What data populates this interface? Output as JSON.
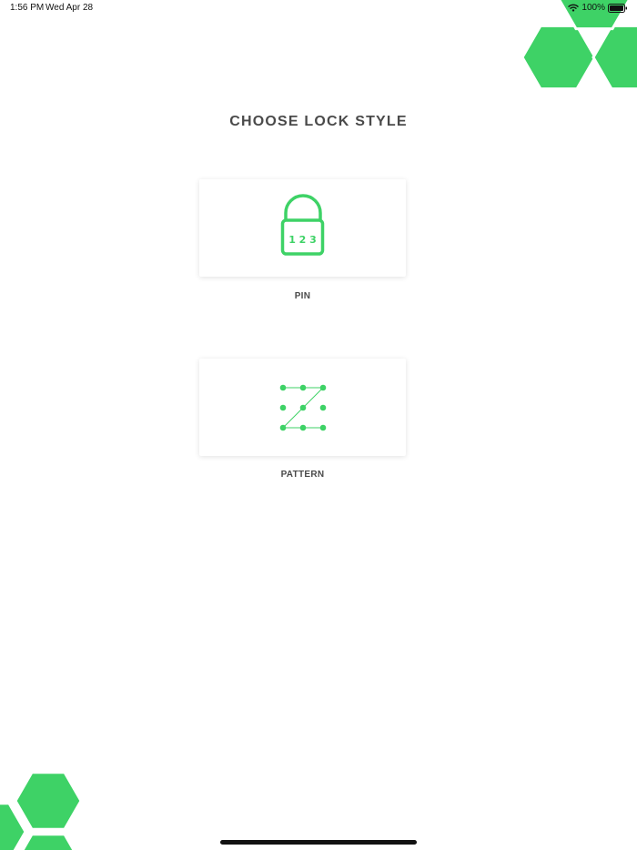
{
  "status_bar": {
    "time": "1:56 PM",
    "date": "Wed Apr 28",
    "battery": "100%"
  },
  "page": {
    "title": "CHOOSE LOCK STYLE"
  },
  "options": [
    {
      "label": "PIN",
      "icon": "padlock-123-icon",
      "icon_text": "1 2 3"
    },
    {
      "label": "PATTERN",
      "icon": "pattern-grid-icon"
    }
  ],
  "colors": {
    "accent": "#3ed266",
    "text": "#4a4a4a",
    "background": "#ffffff"
  }
}
